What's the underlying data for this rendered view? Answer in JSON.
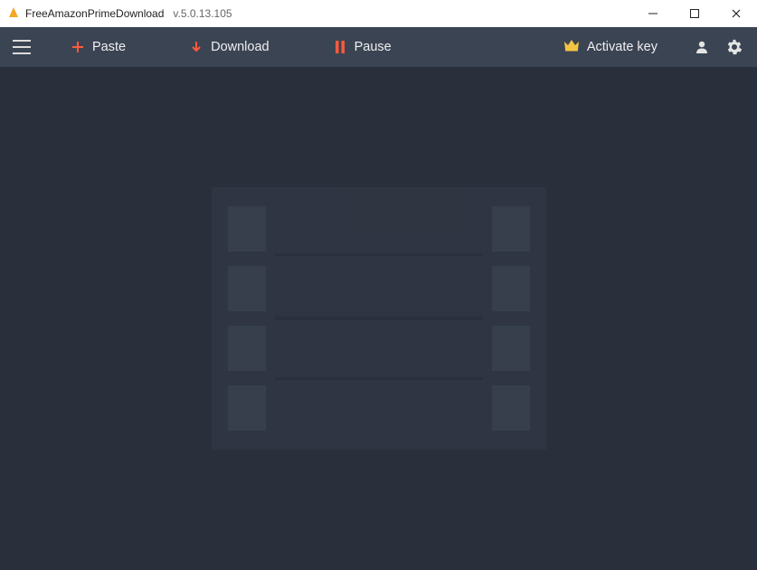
{
  "titlebar": {
    "app_name": "FreeAmazonPrimeDownload",
    "version": "v.5.0.13.105"
  },
  "toolbar": {
    "paste_label": "Paste",
    "download_label": "Download",
    "pause_label": "Pause",
    "activate_label": "Activate key"
  }
}
